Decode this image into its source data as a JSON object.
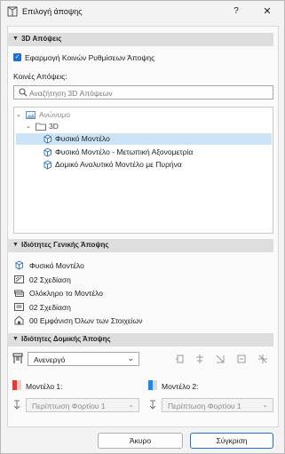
{
  "window": {
    "title": "Επιλογή άποψης",
    "help": "?",
    "close": "✕"
  },
  "section_3d": {
    "header": "3D Απόψεις",
    "apply_common_label": "Εφαρμογή Κοινών Ρυθμίσεων Άποψης",
    "common_views_label": "Κοινές Απόψεις:",
    "search_placeholder": "Αναζήτηση 3D Απόψεων",
    "tree": {
      "root": "Ανώνυμο",
      "folder": "3D",
      "items": [
        "Φυσικό Μοντέλο",
        "Φυσικό Μοντέλο - Μετωπική Αξονομετρία",
        "Δομικό Αναλυτικό Μοντέλο με Πυρήνα"
      ]
    }
  },
  "section_general": {
    "header": "Ιδιότητες Γενικής Άποψης",
    "rows": [
      "Φυσικό Μοντέλο",
      "02 Σχεδίαση",
      "Ολόκληρο το Μοντέλο",
      "02 Σχεδίαση",
      "00 Εμφάνιση Όλων των Στοιχείων"
    ]
  },
  "section_structural": {
    "header": "Ιδιότητες Δομικής Άποψης",
    "mode_value": "Ανενεργό",
    "model1_label": "Μοντέλο 1:",
    "model2_label": "Μοντέλο 2:",
    "load1_value": "Περίπτωση Φορτίου 1",
    "load2_value": "Περίπτωση Φορτίου 1"
  },
  "footer": {
    "cancel": "Άκυρο",
    "compare": "Σύγκριση"
  },
  "colors": {
    "accent": "#1f6fd0",
    "selection": "#cce4f7",
    "model1": "#e53935",
    "model2": "#1e88e5"
  }
}
